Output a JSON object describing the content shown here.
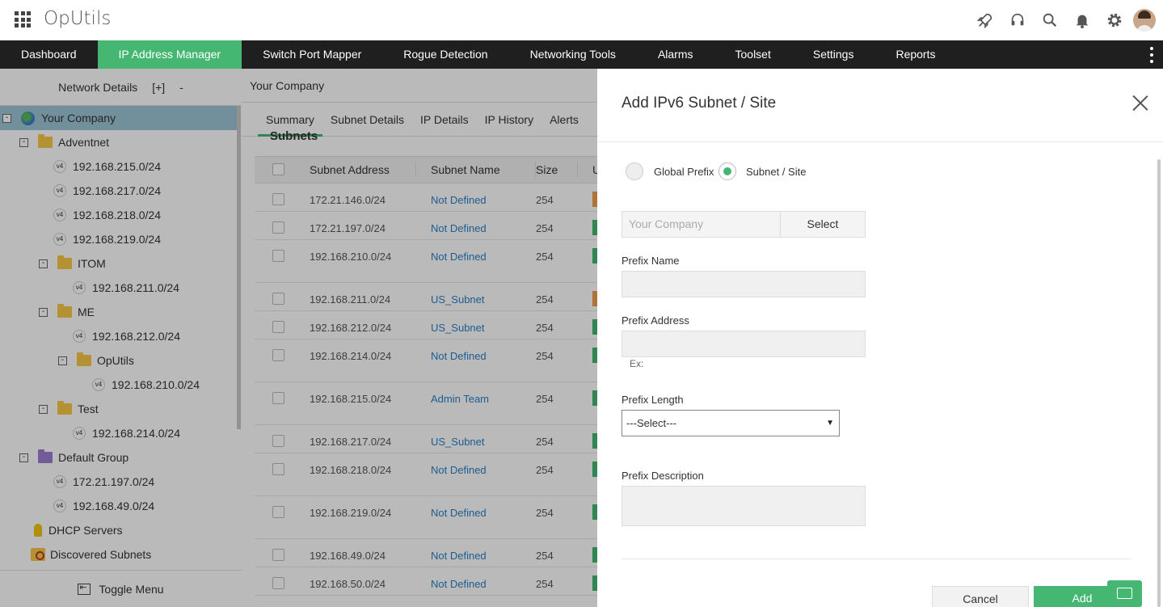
{
  "app": {
    "name": "OpUtils"
  },
  "nav": {
    "items": [
      {
        "label": "Dashboard"
      },
      {
        "label": "IP Address Manager"
      },
      {
        "label": "Switch Port Mapper"
      },
      {
        "label": "Rogue Detection"
      },
      {
        "label": "Networking Tools"
      },
      {
        "label": "Alarms"
      },
      {
        "label": "Toolset"
      },
      {
        "label": "Settings"
      },
      {
        "label": "Reports"
      }
    ],
    "active": "IP Address Manager"
  },
  "sidebar": {
    "title": "Network Details",
    "expand": "[+]",
    "collapse": "-",
    "toggle_menu": "Toggle Menu",
    "tree": [
      {
        "label": "Your Company",
        "type": "root"
      },
      {
        "label": "Adventnet",
        "type": "folder"
      },
      {
        "label": "192.168.215.0/24",
        "type": "subnet"
      },
      {
        "label": "192.168.217.0/24",
        "type": "subnet"
      },
      {
        "label": "192.168.218.0/24",
        "type": "subnet"
      },
      {
        "label": "192.168.219.0/24",
        "type": "subnet"
      },
      {
        "label": "ITOM",
        "type": "folder"
      },
      {
        "label": "192.168.211.0/24",
        "type": "subnet"
      },
      {
        "label": "ME",
        "type": "folder"
      },
      {
        "label": "192.168.212.0/24",
        "type": "subnet"
      },
      {
        "label": "OpUtils",
        "type": "folder"
      },
      {
        "label": "192.168.210.0/24",
        "type": "subnet"
      },
      {
        "label": "Test",
        "type": "folder"
      },
      {
        "label": "192.168.214.0/24",
        "type": "subnet"
      },
      {
        "label": "Default Group",
        "type": "folder"
      },
      {
        "label": "172.21.197.0/24",
        "type": "subnet"
      },
      {
        "label": "192.168.49.0/24",
        "type": "subnet"
      },
      {
        "label": "DHCP Servers",
        "type": "dhcp"
      },
      {
        "label": "Discovered Subnets",
        "type": "discovered"
      }
    ],
    "subnet_badge": "v4",
    "toggle_plus": "+",
    "toggle_minus": "-"
  },
  "main": {
    "heading": "Your Company",
    "tabs": [
      {
        "label": "Summary"
      },
      {
        "label": "Subnet Details"
      },
      {
        "label": "IP Details"
      },
      {
        "label": "IP History"
      },
      {
        "label": "Alerts"
      }
    ],
    "section_label": "Subnets",
    "columns": [
      "Subnet Address",
      "Subnet Name",
      "Size",
      "U"
    ],
    "rows": [
      {
        "address": "172.21.146.0/24",
        "name": "Not Defined",
        "size": "254",
        "util": "orange"
      },
      {
        "address": "172.21.197.0/24",
        "name": "Not Defined",
        "size": "254",
        "util": "green"
      },
      {
        "address": "192.168.210.0/24",
        "name": "Not Defined",
        "size": "254",
        "util": "green"
      },
      {
        "address": "192.168.211.0/24",
        "name": "US_Subnet",
        "size": "254",
        "util": "orange"
      },
      {
        "address": "192.168.212.0/24",
        "name": "US_Subnet",
        "size": "254",
        "util": "green"
      },
      {
        "address": "192.168.214.0/24",
        "name": "Not Defined",
        "size": "254",
        "util": "green"
      },
      {
        "address": "192.168.215.0/24",
        "name": "Admin Team",
        "size": "254",
        "util": "green"
      },
      {
        "address": "192.168.217.0/24",
        "name": "US_Subnet",
        "size": "254",
        "util": "green"
      },
      {
        "address": "192.168.218.0/24",
        "name": "Not Defined",
        "size": "254",
        "util": "green"
      },
      {
        "address": "192.168.219.0/24",
        "name": "Not Defined",
        "size": "254",
        "util": "green"
      },
      {
        "address": "192.168.49.0/24",
        "name": "Not Defined",
        "size": "254",
        "util": "green"
      },
      {
        "address": "192.168.50.0/24",
        "name": "Not Defined",
        "size": "254",
        "util": "green"
      }
    ]
  },
  "dialog": {
    "title": "Add IPv6 Subnet / Site",
    "radio_global": "Global Prefix",
    "radio_subnet": "Subnet / Site",
    "selected_radio": "Subnet / Site",
    "group_placeholder": "Your Company",
    "select_button": "Select",
    "prefix_name_label": "Prefix Name",
    "prefix_name_value": "",
    "prefix_address_label": "Prefix Address",
    "prefix_address_value": "",
    "prefix_address_hint": "Ex:",
    "prefix_length_label": "Prefix Length",
    "prefix_length_value": "---Select---",
    "prefix_description_label": "Prefix Description",
    "prefix_description_value": "",
    "cancel_button": "Cancel",
    "add_button": "Add"
  },
  "colors": {
    "accent": "#45b772",
    "nav_bg": "#1f1f1f",
    "link": "#2a7fc9"
  }
}
